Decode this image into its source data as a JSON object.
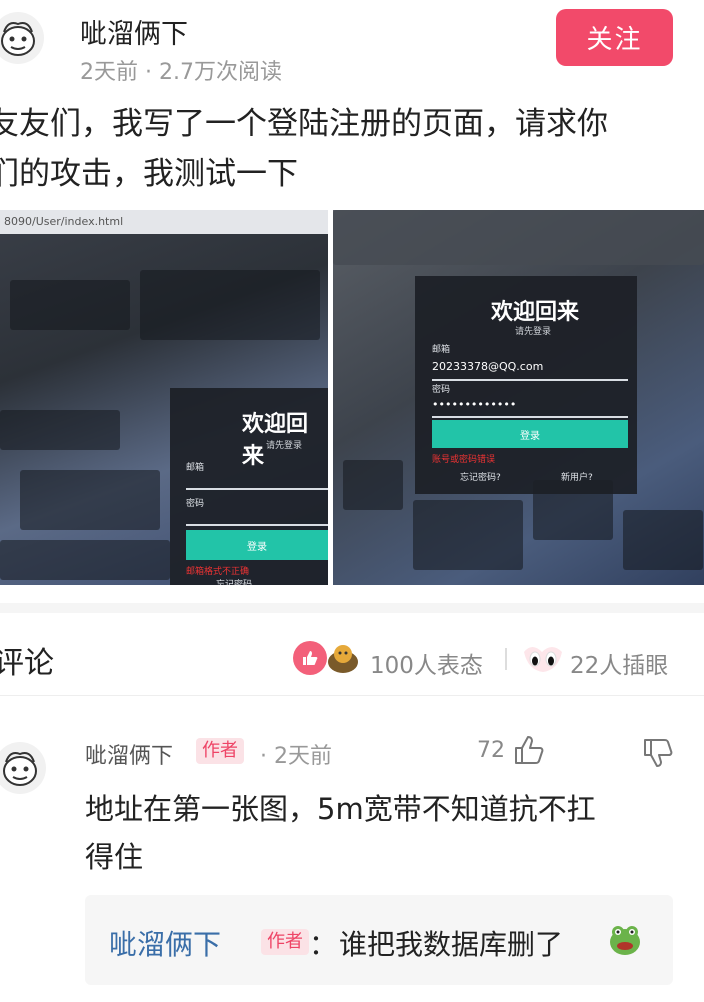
{
  "post": {
    "author": "呲溜俩下",
    "meta": "2天前 · 2.7万次阅读",
    "follow_label": "关注",
    "text_line1": "友友们，我写了一个登陆注册的页面，请求你",
    "text_line2": "们的攻击，我测试一下"
  },
  "images": {
    "first": {
      "url": "8090/User/index.html",
      "title": "欢迎回来",
      "subtitle": "请先登录",
      "email_label": "邮箱",
      "password_label": "密码",
      "button": "登录",
      "error": "邮箱格式不正确",
      "bottom": "忘记密码"
    },
    "second": {
      "title": "欢迎回来",
      "subtitle": "请先登录",
      "email_label": "邮箱",
      "email_value": "20233378@QQ.com",
      "password_label": "密码",
      "password_value": "•••••••••••••",
      "button": "登录",
      "error": "账号或密码错误",
      "forgot": "忘记密码?",
      "new_user": "新用户?"
    }
  },
  "comments_bar": {
    "title": "评论",
    "reactions": "100人表态",
    "views": "22人插眼"
  },
  "comment": {
    "author": "呲溜俩下",
    "badge": "作者",
    "time": "· 2天前",
    "likes": "72",
    "text_line1": "地址在第一张图，5m宽带不知道抗不扛",
    "text_line2": "得住",
    "reply": {
      "author": "呲溜俩下",
      "badge": "作者",
      "colon": "：",
      "text": "谁把我数据库删了"
    }
  },
  "icons": {
    "like": "thumbs-up-icon",
    "dislike": "thumbs-down-icon",
    "reaction": "heart-thumb-icon",
    "eyes": "eyes-icon",
    "frog": "frog-emoji-icon"
  },
  "colors": {
    "accent": "#f24a6a",
    "teal_button": "#22c4a8",
    "reply_name": "#3a6ea8"
  }
}
